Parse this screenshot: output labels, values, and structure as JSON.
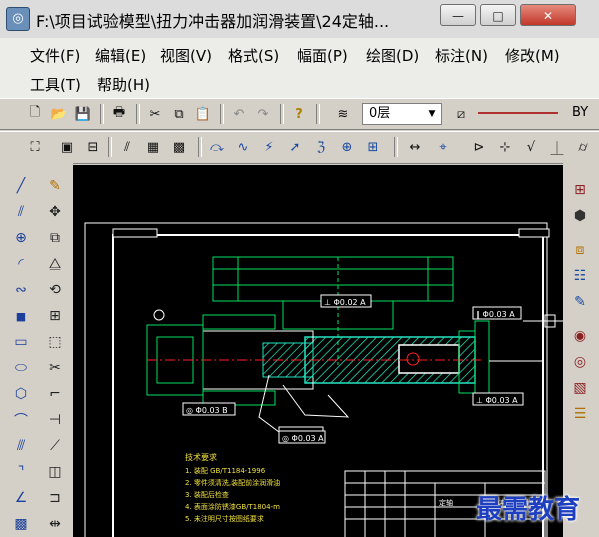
{
  "window": {
    "title": "F:\\项目试验模型\\扭力冲击器加润滑装置\\24定轴...",
    "minimize_label": "—",
    "maximize_label": "□",
    "close_label": "✕"
  },
  "menu": {
    "row1": [
      "文件(F)",
      "编辑(E)",
      "视图(V)",
      "格式(S)",
      "幅面(P)",
      "绘图(D)",
      "标注(N)",
      "修改(M)"
    ],
    "row2": [
      "工具(T)",
      "帮助(H)"
    ]
  },
  "toolbar1": {
    "layer_value": "0层",
    "linetype_value": "BY"
  },
  "drawing": {
    "notes_title": "技术要求",
    "notes": [
      "1. 装配 GB/T1184-1996",
      "2. 零件须清洗,装配前涂润滑油",
      "3. 装配后检查",
      "4. 表面涂防锈漆GB/T1804-m",
      "5. 未注明尺寸按图纸要求"
    ],
    "callouts": [
      "⊥ Φ0.02 A",
      "∥ Φ0.03 A",
      "◎ Φ0.03 B",
      "⊥ Φ0.03 A",
      "◎ Φ0.03 A"
    ],
    "title_block_text": "扭力冲击器润滑装置",
    "title_block_label": "定轴"
  },
  "watermark": "最需教育",
  "colors": {
    "canvas_bg": "#000000",
    "drawing_green": "#00e060",
    "drawing_cyan": "#22e4c0",
    "drawing_white": "#ffffff",
    "drawing_red": "#ff2020",
    "drawing_yellow": "#f0e040",
    "watermark": "#1e3fbf"
  }
}
